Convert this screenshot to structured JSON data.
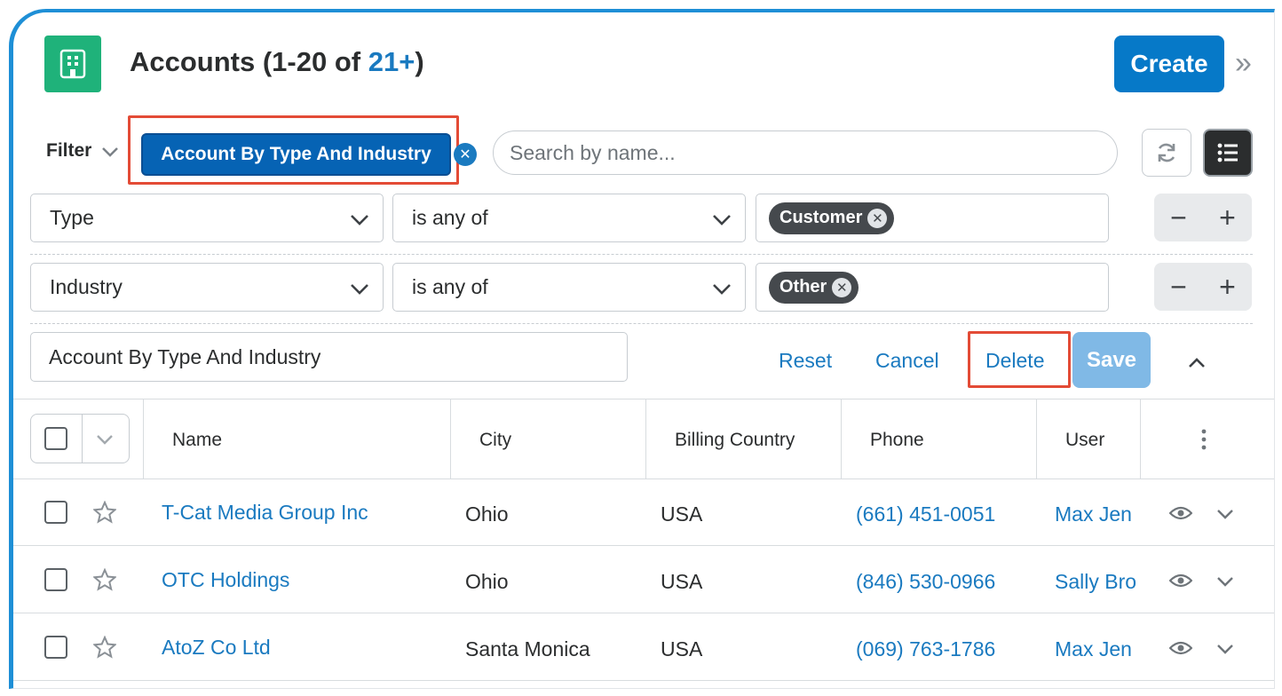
{
  "header": {
    "title_prefix": "Accounts (1-20 of ",
    "title_count": "21+",
    "title_suffix": ")",
    "create_label": "Create",
    "collapse_glyph": "»"
  },
  "filter": {
    "label": "Filter",
    "active_filter": "Account By Type And Industry",
    "clear_glyph": "✕",
    "search_placeholder": "Search by name..."
  },
  "filter_rows": [
    {
      "field": "Type",
      "operator": "is any of",
      "value": "Customer"
    },
    {
      "field": "Industry",
      "operator": "is any of",
      "value": "Other"
    }
  ],
  "filter_editor": {
    "name_value": "Account By Type And Industry",
    "reset_label": "Reset",
    "cancel_label": "Cancel",
    "delete_label": "Delete",
    "save_label": "Save"
  },
  "table": {
    "columns": [
      "Name",
      "City",
      "Billing Country",
      "Phone",
      "User"
    ],
    "rows": [
      {
        "name": "T-Cat Media Group Inc",
        "city": "Ohio",
        "country": "USA",
        "phone": "(661) 451-0051",
        "user": "Max Jen"
      },
      {
        "name": "OTC Holdings",
        "city": "Ohio",
        "country": "USA",
        "phone": "(846) 530-0966",
        "user": "Sally Bro"
      },
      {
        "name": "AtoZ Co Ltd",
        "city": "Santa Monica",
        "country": "USA",
        "phone": "(069) 763-1786",
        "user": "Max Jen"
      }
    ]
  },
  "colors": {
    "accent": "#1e8fd6",
    "primary_button": "#0679c8",
    "module_icon": "#1fb27a",
    "highlight": "#e34b36"
  },
  "icons": [
    "building-icon",
    "chevron-down-icon",
    "refresh-icon",
    "list-view-icon",
    "minus-icon",
    "plus-icon",
    "star-icon",
    "eye-icon",
    "more-vertical-icon",
    "chevron-up-icon"
  ]
}
